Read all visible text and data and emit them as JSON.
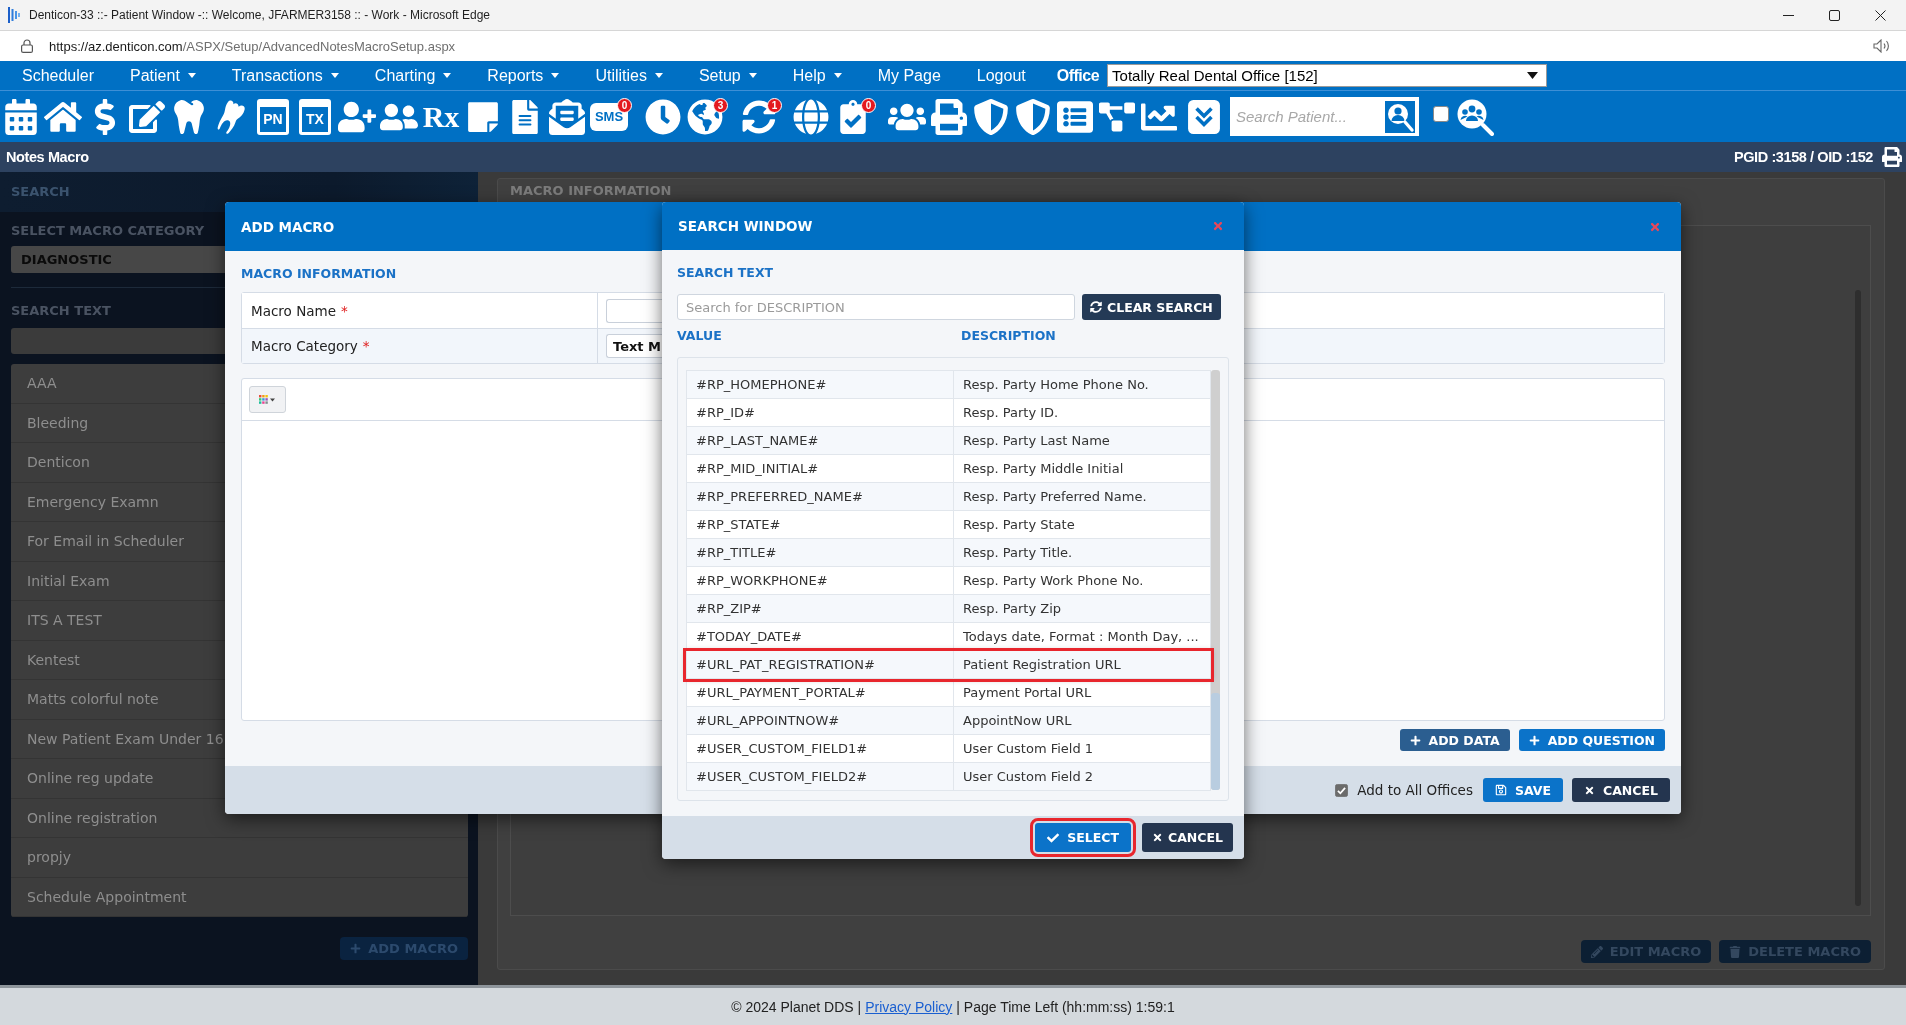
{
  "browser": {
    "title": "Denticon-33 ::- Patient Window -:: Welcome, JFARMER3158 :: - Work - Microsoft Edge",
    "url_origin": "https://az.denticon.com",
    "url_path": "/ASPX/Setup/AdvancedNotesMacroSetup.aspx"
  },
  "menu": {
    "items": [
      {
        "label": "Scheduler",
        "dropdown": false
      },
      {
        "label": "Patient",
        "dropdown": true
      },
      {
        "label": "Transactions",
        "dropdown": true
      },
      {
        "label": "Charting",
        "dropdown": true
      },
      {
        "label": "Reports",
        "dropdown": true
      },
      {
        "label": "Utilities",
        "dropdown": true
      },
      {
        "label": "Setup",
        "dropdown": true
      },
      {
        "label": "Help",
        "dropdown": true
      },
      {
        "label": "My Page",
        "dropdown": false
      },
      {
        "label": "Logout",
        "dropdown": false
      }
    ],
    "office_label": "Office",
    "office_value": "Totally Real Dental Office [152]"
  },
  "toolbar": {
    "buttons": [
      {
        "kind": "calendar"
      },
      {
        "kind": "home"
      },
      {
        "kind": "dollar"
      },
      {
        "kind": "notepad"
      },
      {
        "kind": "toothchart"
      },
      {
        "kind": "tooth"
      },
      {
        "kind": "tile",
        "label": "PN"
      },
      {
        "kind": "tile",
        "label": "TX"
      },
      {
        "kind": "adduser"
      },
      {
        "kind": "addusers"
      },
      {
        "kind": "symbol",
        "label": "Rx"
      },
      {
        "kind": "note"
      },
      {
        "kind": "scan"
      },
      {
        "kind": "mail"
      },
      {
        "kind": "bubble",
        "label": "SMS",
        "badge": "0"
      },
      {
        "kind": "clock"
      },
      {
        "kind": "globeuser",
        "badge": "3"
      },
      {
        "kind": "sync",
        "badge": "1"
      },
      {
        "kind": "globe"
      },
      {
        "kind": "doccheck",
        "badge": "0"
      },
      {
        "kind": "group"
      },
      {
        "kind": "printer"
      },
      {
        "kind": "shieldarrow"
      },
      {
        "kind": "shieldmoney"
      },
      {
        "kind": "ledger"
      },
      {
        "kind": "network"
      },
      {
        "kind": "trend"
      },
      {
        "kind": "collapse"
      }
    ],
    "patient_search": {
      "placeholder": "Search Patient..."
    },
    "option_checkbox": {
      "checked": false
    }
  },
  "page_header": {
    "title": "Notes Macro",
    "ids": "PGID :3158 / OID :152"
  },
  "sidebar": {
    "heading": "SEARCH",
    "category_label": "SELECT MACRO CATEGORY",
    "category_value": "DIAGNOSTIC",
    "search_label": "SEARCH TEXT",
    "macros": [
      {
        "name": "AAA"
      },
      {
        "name": "Bleeding"
      },
      {
        "name": "Denticon"
      },
      {
        "name": "Emergency Examn"
      },
      {
        "name": "For Email in Scheduler"
      },
      {
        "name": "Initial Exam"
      },
      {
        "name": "ITS A TEST"
      },
      {
        "name": "Kentest"
      },
      {
        "name": "Matts colorful note"
      },
      {
        "name": "New Patient Exam Under 16"
      },
      {
        "name": "Online reg update"
      },
      {
        "name": "Online registration"
      },
      {
        "name": "propjy"
      },
      {
        "name": "Schedule Appointment"
      }
    ],
    "add_button": "ADD MACRO"
  },
  "content_panel": {
    "title": "MACRO INFORMATION",
    "edit_button": "EDIT MACRO",
    "delete_button": "DELETE MACRO"
  },
  "add_macro_dialog": {
    "title": "ADD MACRO",
    "section_title": "MACRO INFORMATION",
    "fields": [
      {
        "label": "Macro Name",
        "required_mark": "*",
        "kind": "text"
      },
      {
        "label": "Macro Category",
        "required_mark": "*",
        "kind": "select",
        "value": "Text M"
      }
    ],
    "add_data_button": "ADD DATA",
    "add_question_button": "ADD QUESTION",
    "add_to_all_offices": {
      "label": "Add to All Offices",
      "checked": true
    },
    "save_button": "SAVE",
    "cancel_button": "CANCEL"
  },
  "search_window": {
    "title": "SEARCH WINDOW",
    "search_label": "SEARCH TEXT",
    "search_placeholder": "Search for DESCRIPTION",
    "clear_button": "CLEAR SEARCH",
    "columns": [
      "VALUE",
      "DESCRIPTION"
    ],
    "rows": [
      {
        "value": "#RP_HOMEPHONE#",
        "description": "Resp. Party Home Phone No.",
        "highlighted": false
      },
      {
        "value": "#RP_ID#",
        "description": "Resp. Party ID.",
        "highlighted": false
      },
      {
        "value": "#RP_LAST_NAME#",
        "description": "Resp. Party Last Name",
        "highlighted": false
      },
      {
        "value": "#RP_MID_INITIAL#",
        "description": "Resp. Party Middle Initial",
        "highlighted": false
      },
      {
        "value": "#RP_PREFERRED_NAME#",
        "description": "Resp. Party Preferred Name.",
        "highlighted": false
      },
      {
        "value": "#RP_STATE#",
        "description": "Resp. Party State",
        "highlighted": false
      },
      {
        "value": "#RP_TITLE#",
        "description": "Resp. Party Title.",
        "highlighted": false
      },
      {
        "value": "#RP_WORKPHONE#",
        "description": "Resp. Party Work Phone No.",
        "highlighted": false
      },
      {
        "value": "#RP_ZIP#",
        "description": "Resp. Party Zip",
        "highlighted": false
      },
      {
        "value": "#TODAY_DATE#",
        "description": "Todays date, Format : Month Day, ...",
        "highlighted": false
      },
      {
        "value": "#URL_PAT_REGISTRATION#",
        "description": "Patient Registration URL",
        "highlighted": true
      },
      {
        "value": "#URL_PAYMENT_PORTAL#",
        "description": "Payment Portal URL",
        "highlighted": false
      },
      {
        "value": "#URL_APPOINTNOW#",
        "description": "AppointNow URL",
        "highlighted": false
      },
      {
        "value": "#USER_CUSTOM_FIELD1#",
        "description": "User Custom Field 1",
        "highlighted": false
      },
      {
        "value": "#USER_CUSTOM_FIELD2#",
        "description": "User Custom Field 2",
        "highlighted": false
      }
    ],
    "select_button": {
      "label": "SELECT",
      "highlighted": true
    },
    "cancel_button": "CANCEL"
  },
  "footer": {
    "copyright": "© 2024 Planet DDS |",
    "privacy_link": "Privacy Policy",
    "timer": "| Page Time Left (hh:mm:ss) 1:59:1"
  }
}
